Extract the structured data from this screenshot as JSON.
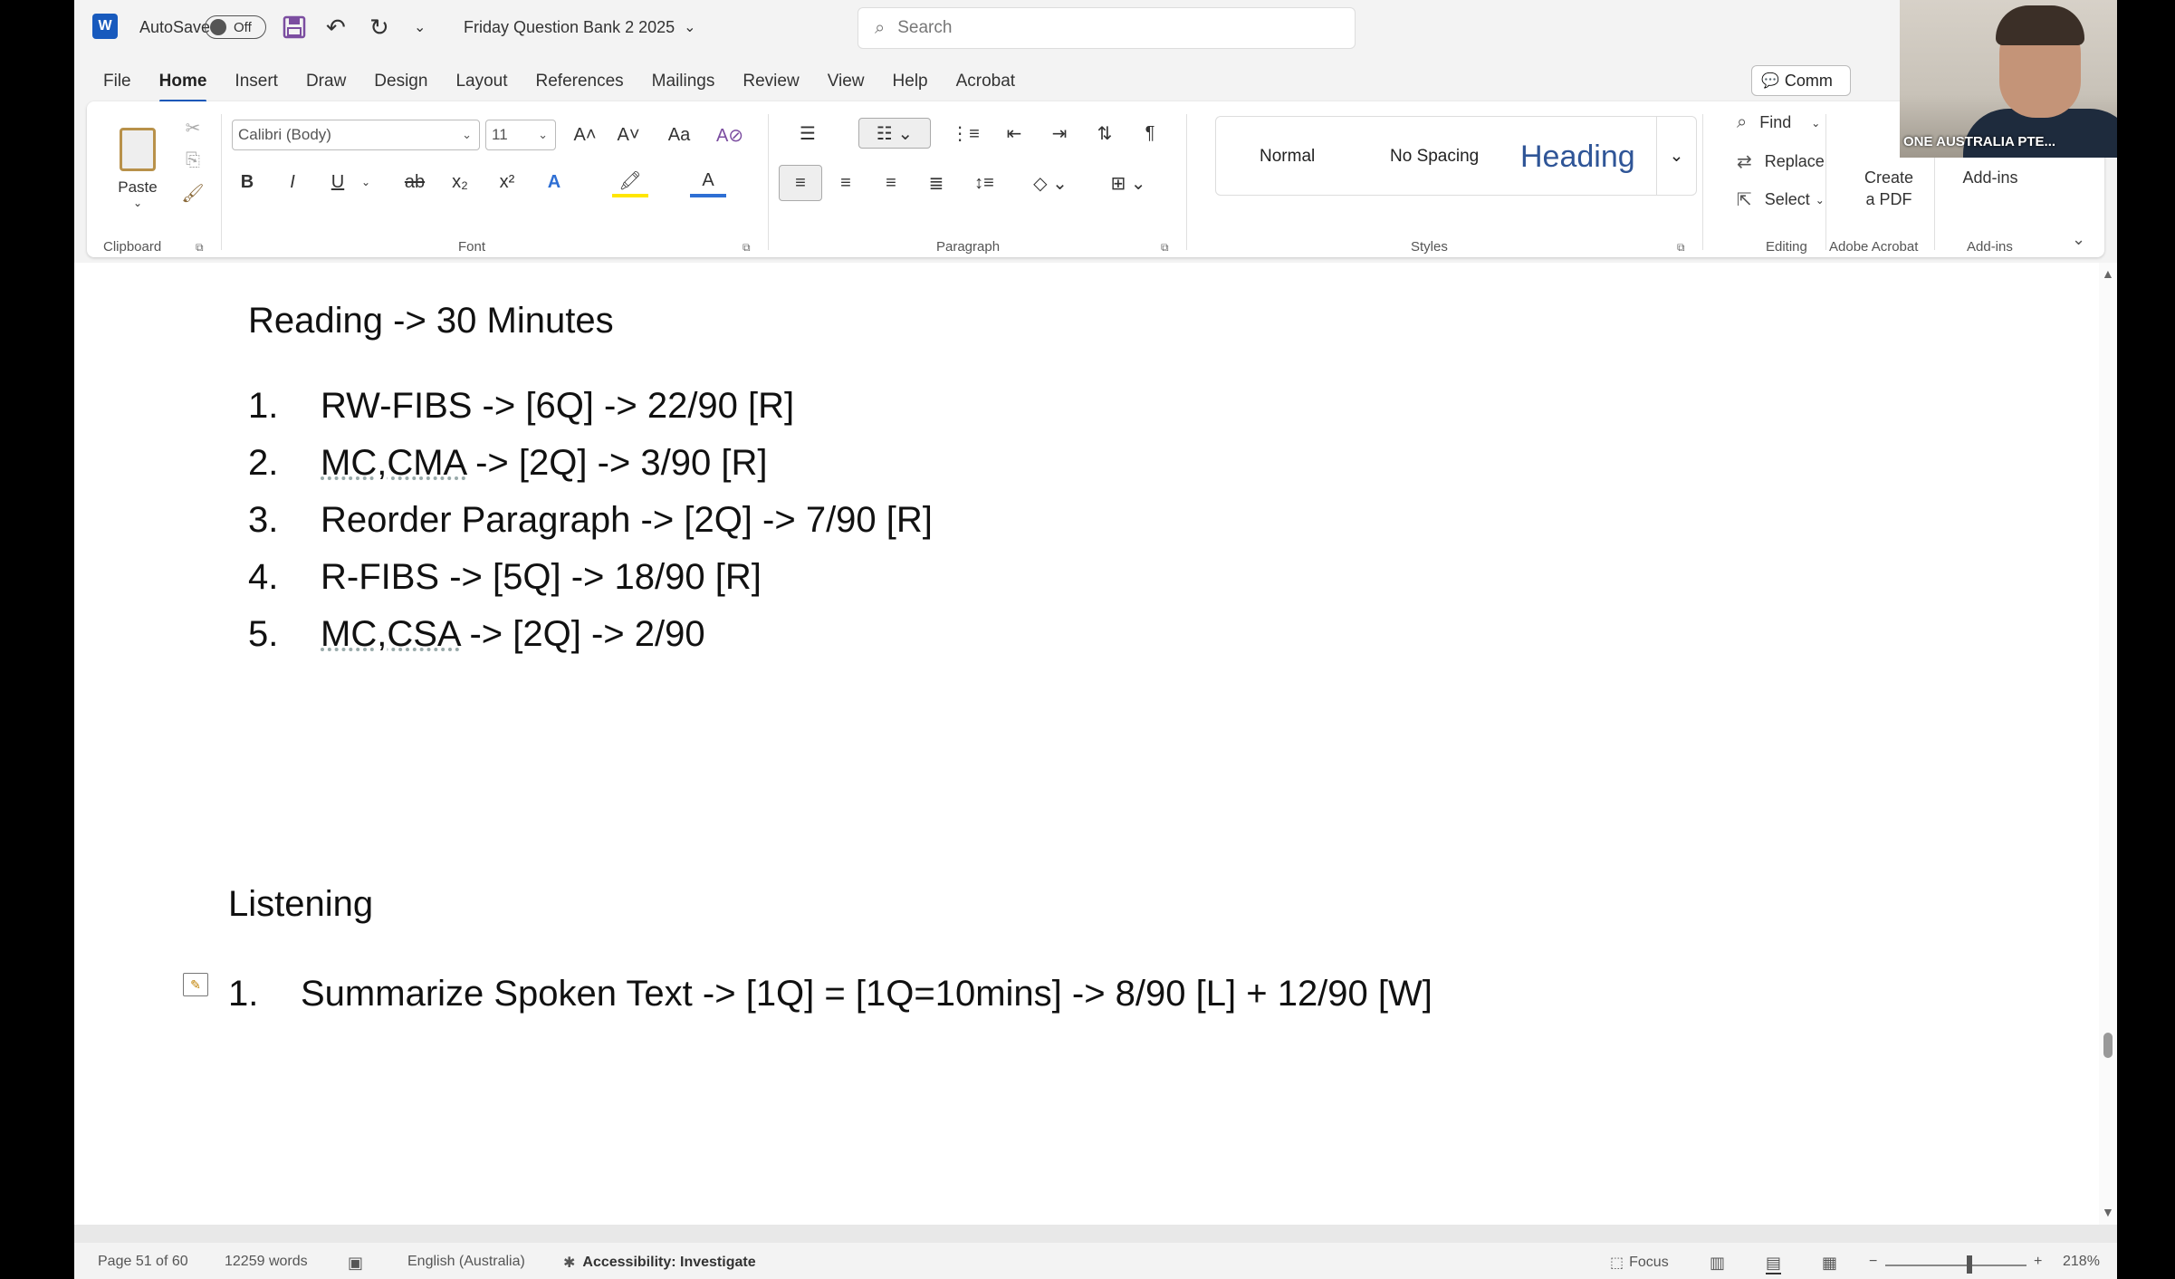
{
  "titlebar": {
    "app_logo": "W",
    "autosave_label": "AutoSave",
    "autosave_state": "Off",
    "doc_title": "Friday Question Bank 2 2025",
    "doc_title_chevron": "⌄",
    "search_placeholder": "Search",
    "search_icon": "⌕",
    "save_icon": "💾",
    "undo_icon": "↶",
    "redo_icon": "↻",
    "qat_icon": "⌄"
  },
  "tabs": [
    "File",
    "Home",
    "Insert",
    "Draw",
    "Design",
    "Layout",
    "References",
    "Mailings",
    "Review",
    "View",
    "Help",
    "Acrobat"
  ],
  "active_tab": "Home",
  "comments_button": "Comm",
  "ribbon": {
    "clipboard": {
      "paste": "Paste",
      "label": "Clipboard"
    },
    "font": {
      "name": "Calibri (Body)",
      "size": "11",
      "label": "Font",
      "grow": "A˄",
      "shrink": "A˅",
      "case": "Aa",
      "clear": "A⊘",
      "bold": "B",
      "italic": "I",
      "underline": "U",
      "strike": "ab",
      "sub": "x₂",
      "sup": "x²",
      "effects": "A",
      "highlight": "🖍",
      "color": "A"
    },
    "paragraph": {
      "label": "Paragraph",
      "pilcrow": "¶"
    },
    "styles": {
      "label": "Styles",
      "normal": "Normal",
      "no_spacing": "No Spacing",
      "heading": "Heading",
      "more": "⌄"
    },
    "editing": {
      "label": "Editing",
      "find": "Find",
      "replace": "Replace",
      "select": "Select"
    },
    "acrobat": {
      "label": "Adobe Acrobat",
      "create_line1": "Create",
      "create_line2": "a PDF"
    },
    "addins": {
      "label": "Add-ins",
      "button": "Add-ins"
    },
    "collapse": "⌄"
  },
  "webcam": {
    "label": "ONE AUSTRALIA PTE..."
  },
  "document": {
    "reading_heading": "Reading -> 30 Minutes",
    "reading_items": [
      {
        "num": "1.",
        "pre": "RW-FIBS",
        "post": " -> [6Q] -> 22/90 [R]",
        "underlined": false
      },
      {
        "num": "2.",
        "pre": "MC,CMA",
        "post": " -> [2Q] -> 3/90 [R]",
        "underlined": true
      },
      {
        "num": "3.",
        "pre": "Reorder Paragraph",
        "post": " -> [2Q] -> 7/90 [R]",
        "underlined": false
      },
      {
        "num": "4.",
        "pre": "R-FIBS",
        "post": " -> [5Q] -> 18/90 [R]",
        "underlined": false
      },
      {
        "num": "5.",
        "pre": "MC,CSA",
        "post": " -> [2Q] -> 2/90",
        "underlined": true
      }
    ],
    "listening_heading": "Listening",
    "listening_items": [
      {
        "num": "1.",
        "text": "Summarize Spoken Text -> [1Q] = [1Q=10mins] -> 8/90 [L] + 12/90 [W]"
      }
    ]
  },
  "status": {
    "page": "Page 51 of 60",
    "words": "12259 words",
    "language": "English (Australia)",
    "accessibility": "Accessibility: Investigate",
    "focus": "Focus",
    "zoom": "218%",
    "zoom_minus": "−",
    "zoom_plus": "+"
  }
}
